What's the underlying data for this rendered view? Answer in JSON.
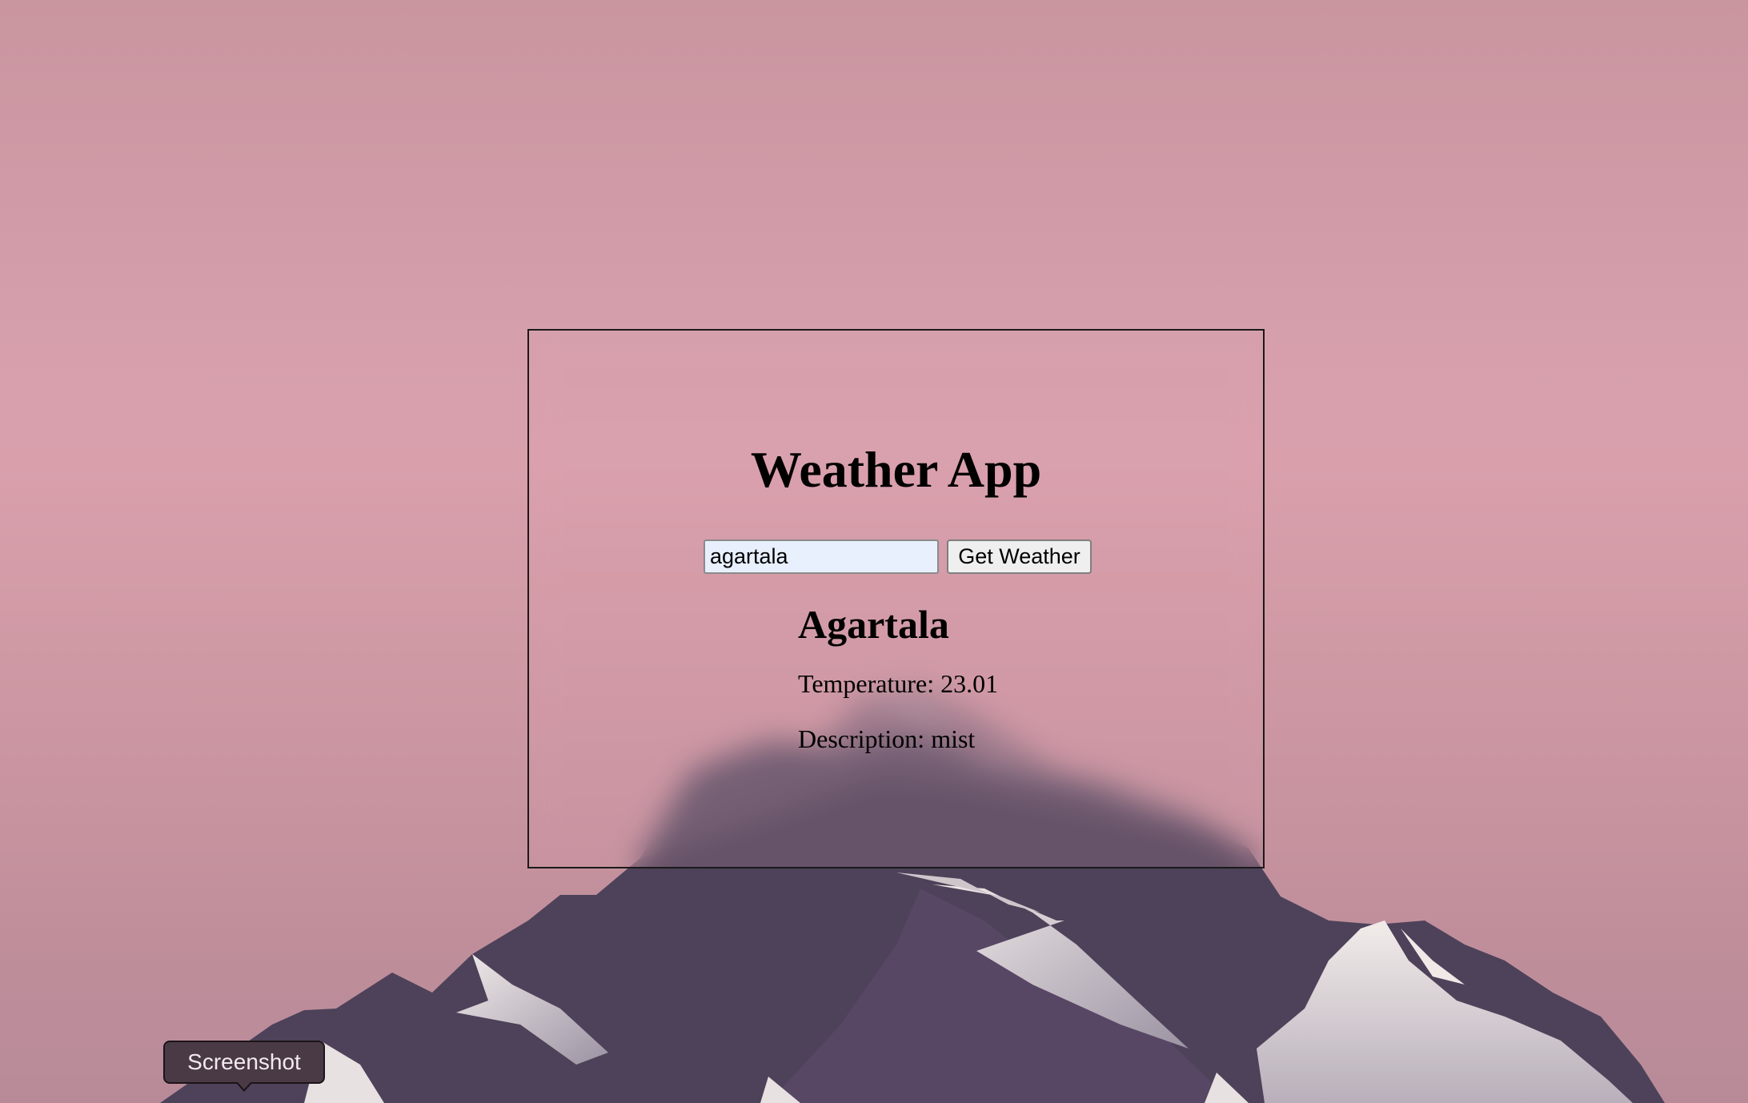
{
  "app": {
    "title": "Weather App"
  },
  "search": {
    "input_value": "agartala",
    "button_label": "Get Weather"
  },
  "result": {
    "city": "Agartala",
    "temperature_label": "Temperature: 23.01",
    "description_label": "Description: mist"
  },
  "tooltip": {
    "label": "Screenshot"
  },
  "colors": {
    "background_pink": "#d59fab",
    "mountain_dark": "#4d4259",
    "snow": "#e9e2e2",
    "input_bg": "#e8f0fe"
  }
}
